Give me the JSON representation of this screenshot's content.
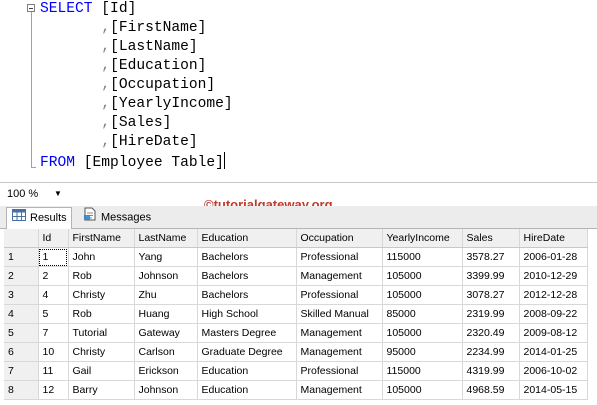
{
  "editor": {
    "lines": [
      {
        "kw": "SELECT",
        "sep": "",
        "text": " [Id]",
        "indent": ""
      },
      {
        "kw": "",
        "sep": ",",
        "text": "[FirstName]",
        "indent": "       "
      },
      {
        "kw": "",
        "sep": ",",
        "text": "[LastName]",
        "indent": "       "
      },
      {
        "kw": "",
        "sep": ",",
        "text": "[Education]",
        "indent": "       "
      },
      {
        "kw": "",
        "sep": ",",
        "text": "[Occupation]",
        "indent": "       "
      },
      {
        "kw": "",
        "sep": ",",
        "text": "[YearlyIncome]",
        "indent": "       "
      },
      {
        "kw": "",
        "sep": ",",
        "text": "[Sales]",
        "indent": "       "
      },
      {
        "kw": "",
        "sep": ",",
        "text": "[HireDate]",
        "indent": "       "
      },
      {
        "kw": "FROM",
        "sep": "",
        "text": " [Employee Table]",
        "indent": ""
      }
    ]
  },
  "zoom": {
    "value": "100 %"
  },
  "watermark": "©tutorialgateway.org",
  "tabs": {
    "results": "Results",
    "messages": "Messages"
  },
  "grid": {
    "columns": [
      "Id",
      "FirstName",
      "LastName",
      "Education",
      "Occupation",
      "YearlyIncome",
      "Sales",
      "HireDate"
    ],
    "rows": [
      [
        "1",
        "1",
        "John",
        "Yang",
        "Bachelors",
        "Professional",
        "115000",
        "3578.27",
        "2006-01-28"
      ],
      [
        "2",
        "2",
        "Rob",
        "Johnson",
        "Bachelors",
        "Management",
        "105000",
        "3399.99",
        "2010-12-29"
      ],
      [
        "3",
        "4",
        "Christy",
        "Zhu",
        "Bachelors",
        "Professional",
        "105000",
        "3078.27",
        "2012-12-28"
      ],
      [
        "4",
        "5",
        "Rob",
        "Huang",
        "High School",
        "Skilled Manual",
        "85000",
        "2319.99",
        "2008-09-22"
      ],
      [
        "5",
        "7",
        "Tutorial",
        "Gateway",
        "Masters Degree",
        "Management",
        "105000",
        "2320.49",
        "2009-08-12"
      ],
      [
        "6",
        "10",
        "Christy",
        "Carlson",
        "Graduate Degree",
        "Management",
        "95000",
        "2234.99",
        "2014-01-25"
      ],
      [
        "7",
        "11",
        "Gail",
        "Erickson",
        "Education",
        "Professional",
        "115000",
        "4319.99",
        "2006-10-02"
      ],
      [
        "8",
        "12",
        "Barry",
        "Johnson",
        "Education",
        "Management",
        "105000",
        "4968.59",
        "2014-05-15"
      ]
    ]
  },
  "colors": {
    "keyword": "#0000ff",
    "separator": "#808080",
    "watermark": "#c0392b"
  },
  "icons": {
    "results_tab": "grid-icon",
    "messages_tab": "messages-icon",
    "zoom_dropdown": "dropdown-arrow-icon"
  }
}
